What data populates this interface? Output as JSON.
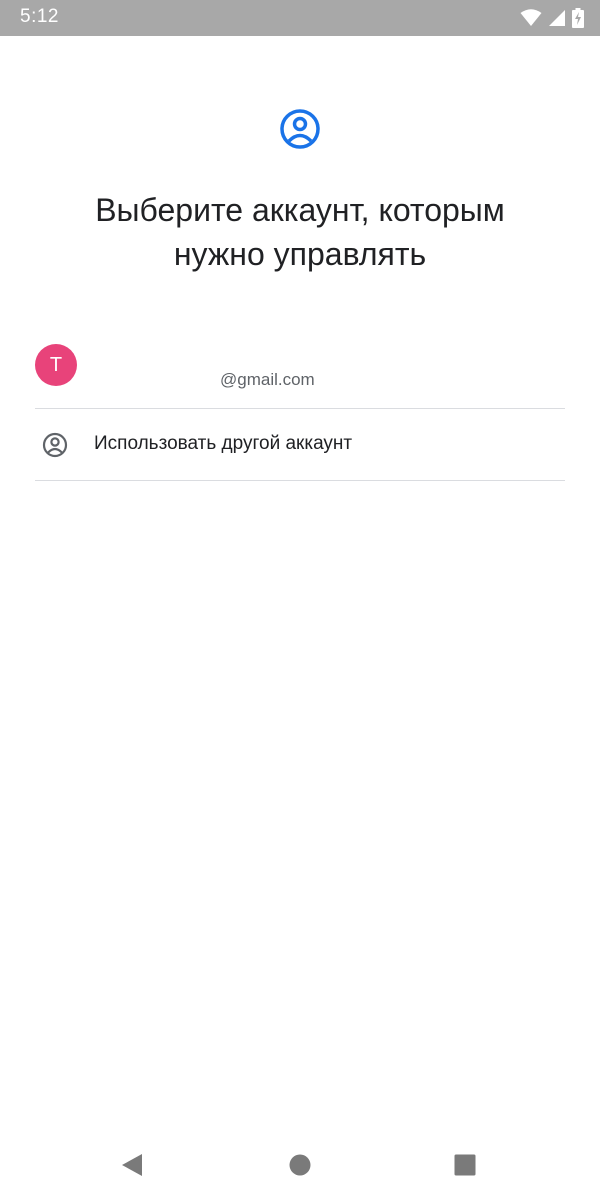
{
  "status_bar": {
    "time": "5:12",
    "icons": [
      "wifi-icon",
      "signal-icon",
      "battery-charging-icon"
    ]
  },
  "header": {
    "icon": "account-circle-icon",
    "title_line1": "Выберите аккаунт, которым",
    "title_line2": "нужно управлять"
  },
  "accounts": [
    {
      "avatar_letter": "T",
      "avatar_color": "#e8437a",
      "email": "@gmail.com"
    }
  ],
  "other_account": {
    "icon": "account-circle-icon",
    "label": "Использовать другой аккаунт"
  },
  "navigation": {
    "buttons": [
      "back-icon",
      "home-icon",
      "recents-icon"
    ]
  },
  "colors": {
    "accent": "#1a73e8",
    "status_bar": "#a8a8a8"
  }
}
